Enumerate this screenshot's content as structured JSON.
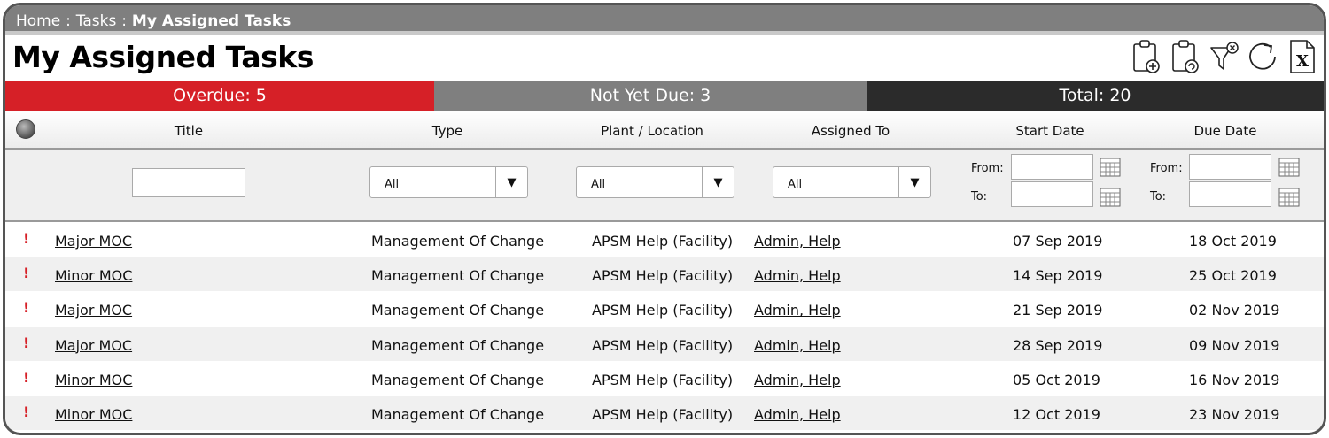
{
  "breadcrumb": {
    "home": "Home",
    "tasks": "Tasks",
    "sep1": ":",
    "sep2": ":",
    "current": "My Assigned Tasks"
  },
  "page_title": "My Assigned Tasks",
  "toolbar": {
    "icons": [
      "add-task-icon",
      "copy-task-icon",
      "clear-filter-icon",
      "refresh-icon",
      "export-excel-icon"
    ],
    "excel_glyph": "X"
  },
  "summary": {
    "overdue": "Overdue: 5",
    "not_yet_due": "Not Yet Due: 3",
    "total": "Total: 20",
    "colors": {
      "overdue": "#d62027",
      "not_yet_due": "#7f7f7f",
      "total": "#2b2b2b"
    }
  },
  "columns": {
    "title": "Title",
    "type": "Type",
    "plant": "Plant / Location",
    "assigned": "Assigned To",
    "start": "Start Date",
    "due": "Due Date"
  },
  "filters": {
    "title_value": "",
    "type_selected": "All",
    "plant_selected": "All",
    "assigned_selected": "All",
    "from_label": "From:",
    "to_label": "To:"
  },
  "rows": [
    {
      "flag": "!",
      "title": "Major MOC",
      "type": "Management Of Change",
      "plant": "APSM Help (Facility)",
      "assigned": "Admin, Help",
      "start": "07 Sep 2019",
      "due": "18 Oct 2019"
    },
    {
      "flag": "!",
      "title": "Minor MOC",
      "type": "Management Of Change",
      "plant": "APSM Help (Facility)",
      "assigned": "Admin, Help",
      "start": "14 Sep 2019",
      "due": "25 Oct 2019"
    },
    {
      "flag": "!",
      "title": "Major MOC",
      "type": "Management Of Change",
      "plant": "APSM Help (Facility)",
      "assigned": "Admin, Help",
      "start": "21 Sep 2019",
      "due": "02 Nov 2019"
    },
    {
      "flag": "!",
      "title": "Major MOC",
      "type": "Management Of Change",
      "plant": "APSM Help (Facility)",
      "assigned": "Admin, Help",
      "start": "28 Sep 2019",
      "due": "09 Nov 2019"
    },
    {
      "flag": "!",
      "title": "Minor MOC",
      "type": "Management Of Change",
      "plant": "APSM Help (Facility)",
      "assigned": "Admin, Help",
      "start": "05 Oct 2019",
      "due": "16 Nov 2019"
    },
    {
      "flag": "!",
      "title": "Minor MOC",
      "type": "Management Of Change",
      "plant": "APSM Help (Facility)",
      "assigned": "Admin, Help",
      "start": "12 Oct 2019",
      "due": "23 Nov 2019"
    }
  ]
}
